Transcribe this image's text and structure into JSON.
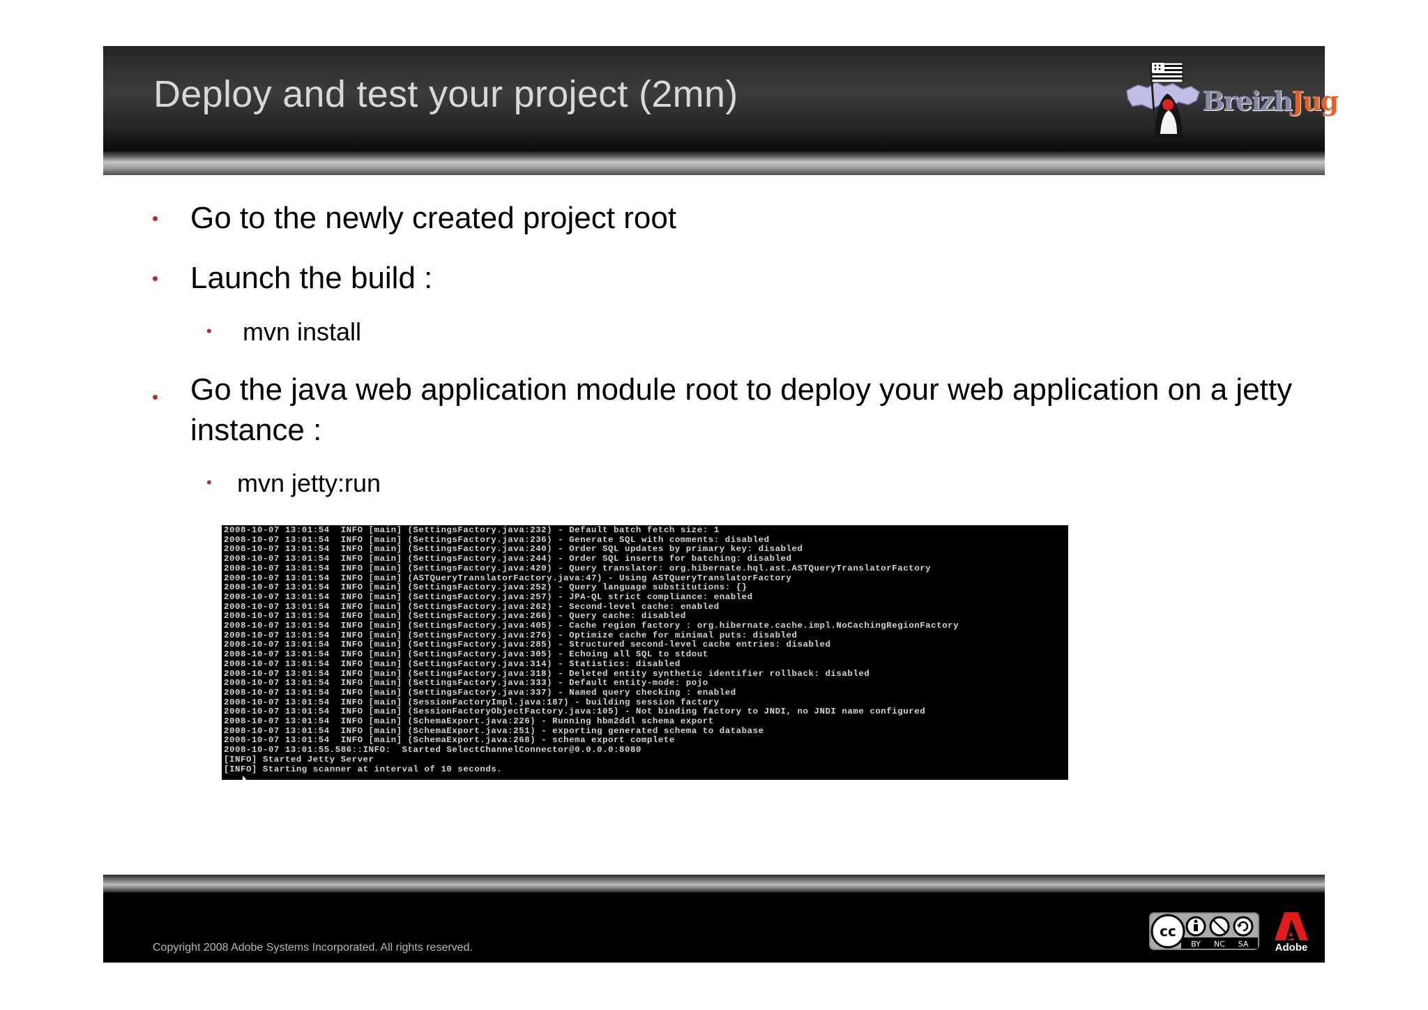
{
  "slide": {
    "title": "Deploy and test your project  (2mn)",
    "logo": {
      "text_breizh": "Breizh",
      "text_jug": "Jug"
    },
    "bullets": [
      "Go to the newly created project root",
      "Launch the build :",
      "Go the java web application module root to deploy your web application on a  jetty instance :"
    ],
    "sub_bullets": [
      "mvn install",
      "mvn jetty:run"
    ],
    "bullet_marker": "•",
    "console_lines": [
      "2008-10-07 13:01:54  INFO [main] (SettingsFactory.java:232) - Default batch fetch size: 1",
      "2008-10-07 13:01:54  INFO [main] (SettingsFactory.java:236) - Generate SQL with comments: disabled",
      "2008-10-07 13:01:54  INFO [main] (SettingsFactory.java:240) - Order SQL updates by primary key: disabled",
      "2008-10-07 13:01:54  INFO [main] (SettingsFactory.java:244) - Order SQL inserts for batching: disabled",
      "2008-10-07 13:01:54  INFO [main] (SettingsFactory.java:420) - Query translator: org.hibernate.hql.ast.ASTQueryTranslatorFactory",
      "2008-10-07 13:01:54  INFO [main] (ASTQueryTranslatorFactory.java:47) - Using ASTQueryTranslatorFactory",
      "2008-10-07 13:01:54  INFO [main] (SettingsFactory.java:252) - Query language substitutions: {}",
      "2008-10-07 13:01:54  INFO [main] (SettingsFactory.java:257) - JPA-QL strict compliance: enabled",
      "2008-10-07 13:01:54  INFO [main] (SettingsFactory.java:262) - Second-level cache: enabled",
      "2008-10-07 13:01:54  INFO [main] (SettingsFactory.java:266) - Query cache: disabled",
      "2008-10-07 13:01:54  INFO [main] (SettingsFactory.java:405) - Cache region factory : org.hibernate.cache.impl.NoCachingRegionFactory",
      "2008-10-07 13:01:54  INFO [main] (SettingsFactory.java:276) - Optimize cache for minimal puts: disabled",
      "2008-10-07 13:01:54  INFO [main] (SettingsFactory.java:285) - Structured second-level cache entries: disabled",
      "2008-10-07 13:01:54  INFO [main] (SettingsFactory.java:305) - Echoing all SQL to stdout",
      "2008-10-07 13:01:54  INFO [main] (SettingsFactory.java:314) - Statistics: disabled",
      "2008-10-07 13:01:54  INFO [main] (SettingsFactory.java:318) - Deleted entity synthetic identifier rollback: disabled",
      "2008-10-07 13:01:54  INFO [main] (SettingsFactory.java:333) - Default entity-mode: pojo",
      "2008-10-07 13:01:54  INFO [main] (SettingsFactory.java:337) - Named query checking : enabled",
      "2008-10-07 13:01:54  INFO [main] (SessionFactoryImpl.java:187) - building session factory",
      "2008-10-07 13:01:54  INFO [main] (SessionFactoryObjectFactory.java:105) - Not binding factory to JNDI, no JNDI name configured",
      "2008-10-07 13:01:54  INFO [main] (SchemaExport.java:226) - Running hbm2ddl schema export",
      "2008-10-07 13:01:54  INFO [main] (SchemaExport.java:251) - exporting generated schema to database",
      "2008-10-07 13:01:54  INFO [main] (SchemaExport.java:268) - schema export complete",
      "2008-10-07 13:01:55.586::INFO:  Started SelectChannelConnector@0.0.0.0:8080",
      "[INFO] Started Jetty Server",
      "[INFO] Starting scanner at interval of 10 seconds."
    ]
  },
  "footer": {
    "copyright": "Copyright 2008 Adobe Systems Incorporated.  All rights reserved.",
    "cc_badge": {
      "mark": "cc",
      "labels": [
        "BY",
        "NC",
        "SA"
      ]
    },
    "adobe_label": "Adobe"
  },
  "colors": {
    "bullet": "#b22a2a",
    "title_text": "#d8d8d8",
    "logo_breizh": "#8787a7",
    "logo_jug": "#e0622a",
    "console_bg": "#000000",
    "console_text": "#d4d4d4",
    "adobe_red": "#e21b1b"
  },
  "icons": [
    "breizhjug-logo-icon",
    "creative-commons-icon",
    "adobe-logo-icon"
  ]
}
